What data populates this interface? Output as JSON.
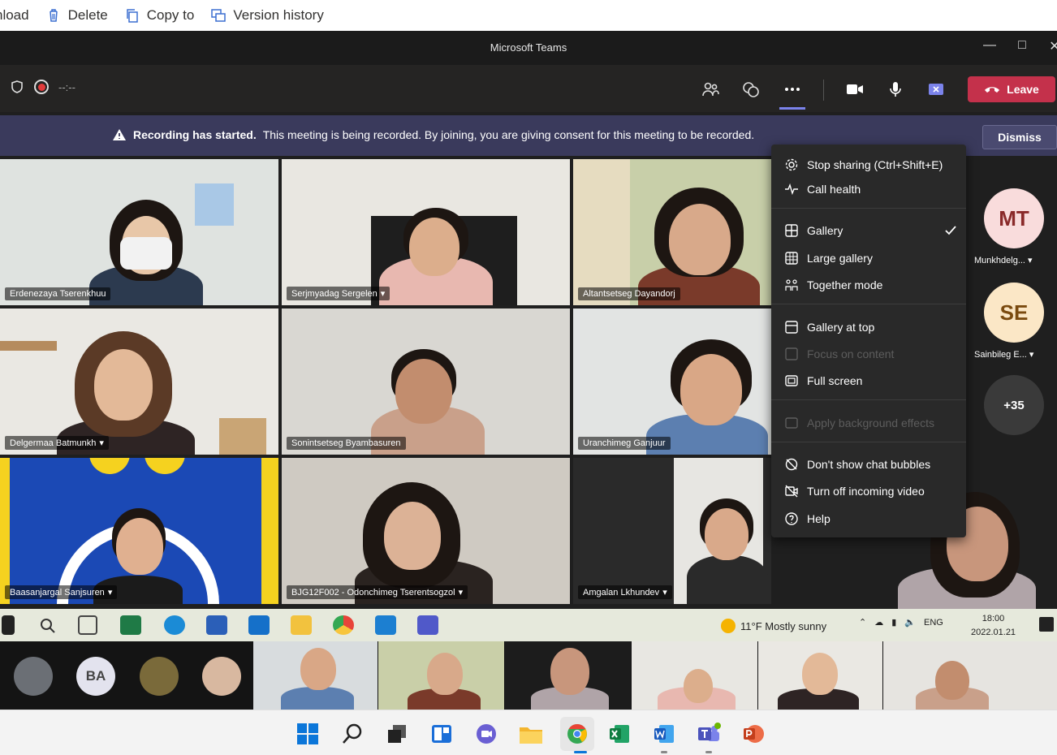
{
  "explorer_toolbar": {
    "download": "nload",
    "delete": "Delete",
    "copy_to": "Copy to",
    "version_history": "Version history"
  },
  "teams": {
    "window_title": "Microsoft Teams",
    "timer": "--:--",
    "leave_label": "Leave",
    "banner": {
      "bold": "Recording has started.",
      "text": "This meeting is being recorded. By joining, you are giving consent for this meeting to be recorded.",
      "dismiss": "Dismiss"
    },
    "participants": [
      "Erdenezaya Tserenkhuu",
      "Serjmyadag Sergelen",
      "Altantsetseg Dayandorj",
      "Delgermaa Batmunkh",
      "Sonintsetseg Byambasuren",
      "Uranchimeg Ganjuur",
      "Baasanjargal Sanjsuren",
      "BJG12F002 - Odonchimeg Tserentsogzol",
      "Amgalan Lkhundev"
    ],
    "menu": {
      "stop_sharing": "Stop sharing (Ctrl+Shift+E)",
      "call_health": "Call health",
      "gallery": "Gallery",
      "large_gallery": "Large gallery",
      "together_mode": "Together mode",
      "gallery_at_top": "Gallery at top",
      "focus_on_content": "Focus on content",
      "full_screen": "Full screen",
      "apply_bg": "Apply background effects",
      "dont_show_chat": "Don't show chat bubbles",
      "turn_off_video": "Turn off incoming video",
      "help": "Help"
    },
    "roster": [
      {
        "initials": "MT",
        "name": "Munkhdelg...",
        "bg": "#f9dcdc",
        "fg": "#8a2a2a"
      },
      {
        "initials": "SE",
        "name": "Sainbileg E...",
        "bg": "#fbe7c6",
        "fg": "#7a4a0f"
      },
      {
        "initials": "+35",
        "name": "",
        "bg": "#3a3a3a",
        "fg": "#ffffff"
      }
    ]
  },
  "desktop_taskbar": {
    "weather": "11°F  Mostly sunny",
    "lang": "ENG",
    "time": "18:00",
    "date": "2022.01.21"
  },
  "strip": {
    "avatar_initials": "BA"
  },
  "colors": {
    "leave_red": "#c4314b",
    "teams_purple": "#7b83eb",
    "banner_bg": "#3a3a5c"
  }
}
